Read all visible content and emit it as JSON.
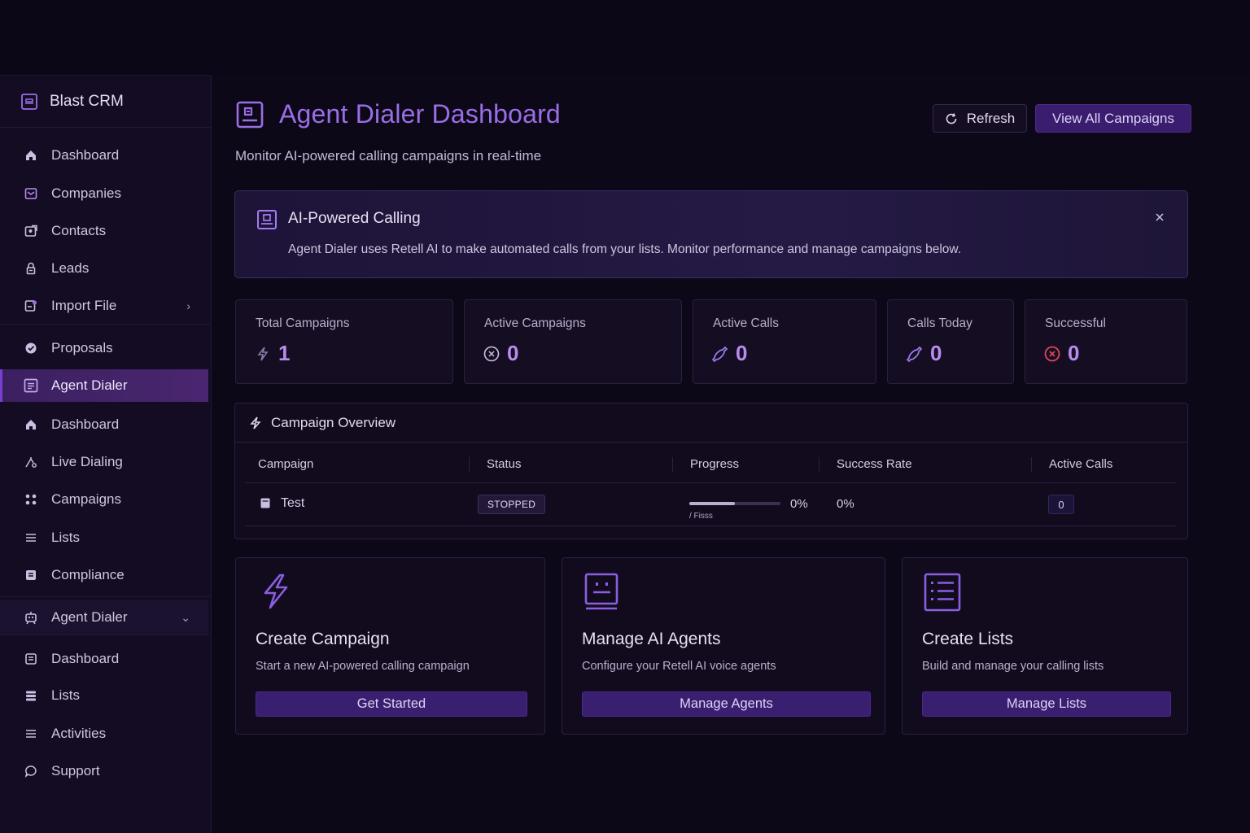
{
  "app": {
    "brand": "Blast CRM"
  },
  "sidebar": {
    "items": [
      {
        "label": "Dashboard",
        "icon": "home-icon"
      },
      {
        "label": "Companies",
        "icon": "building-icon"
      },
      {
        "label": "Contacts",
        "icon": "contact-card-icon"
      },
      {
        "label": "Leads",
        "icon": "lock-icon"
      },
      {
        "label": "Import File",
        "icon": "file-import-icon"
      },
      {
        "label": "Proposals",
        "icon": "badge-check-icon"
      },
      {
        "label": "Agent Dialer",
        "icon": "dialer-icon"
      },
      {
        "label": "Dashboard",
        "icon": "home-icon"
      },
      {
        "label": "Live Dialing",
        "icon": "signal-icon"
      },
      {
        "label": "Campaigns",
        "icon": "grid-dots-icon"
      },
      {
        "label": "Lists",
        "icon": "list-icon"
      },
      {
        "label": "Compliance",
        "icon": "document-icon"
      },
      {
        "label": "Agent Dialer",
        "icon": "robot-icon"
      },
      {
        "label": "Dashboard",
        "icon": "document-icon"
      },
      {
        "label": "Lists",
        "icon": "stack-icon"
      },
      {
        "label": "Activities",
        "icon": "list-icon"
      },
      {
        "label": "Support",
        "icon": "chat-bubble-icon"
      }
    ]
  },
  "header": {
    "title": "Agent Dialer Dashboard",
    "subtitle": "Monitor AI-powered calling campaigns in real-time",
    "refresh_label": "Refresh",
    "view_all_label": "View All Campaigns"
  },
  "banner": {
    "title": "AI-Powered Calling",
    "text": "Agent Dialer uses Retell AI to make automated calls from your lists. Monitor performance and manage campaigns below."
  },
  "stats": [
    {
      "label": "Total Campaigns",
      "value": "1",
      "icon": "bolt-icon"
    },
    {
      "label": "Active Campaigns",
      "value": "0",
      "icon": "clock-x-icon"
    },
    {
      "label": "Active Calls",
      "value": "0",
      "icon": "phone-icon"
    },
    {
      "label": "Calls Today",
      "value": "0",
      "icon": "phone-icon"
    },
    {
      "label": "Successful",
      "value": "0",
      "icon": "x-circle-icon"
    }
  ],
  "overview": {
    "title": "Campaign Overview",
    "columns": [
      "Campaign",
      "Status",
      "Progress",
      "Success Rate",
      "Active Calls"
    ],
    "rows": [
      {
        "campaign": "Test",
        "status": "STOPPED",
        "progress": "0%",
        "progress_sub": "/ Fisss",
        "progress_fill": 0.5,
        "success_rate": "0%",
        "active_calls": "0"
      }
    ]
  },
  "cards": [
    {
      "title": "Create Campaign",
      "desc": "Start a new AI-powered calling campaign",
      "button": "Get Started",
      "icon": "bolt-icon"
    },
    {
      "title": "Manage AI Agents",
      "desc": "Configure your Retell AI voice agents",
      "button": "Manage Agents",
      "icon": "robot-face-icon"
    },
    {
      "title": "Create Lists",
      "desc": "Build and manage your calling lists",
      "button": "Manage Lists",
      "icon": "checklist-icon"
    }
  ],
  "colors": {
    "accent": "#9a6ee6",
    "button": "#3a1f70",
    "background": "#0d0818",
    "danger": "#e0465a"
  }
}
